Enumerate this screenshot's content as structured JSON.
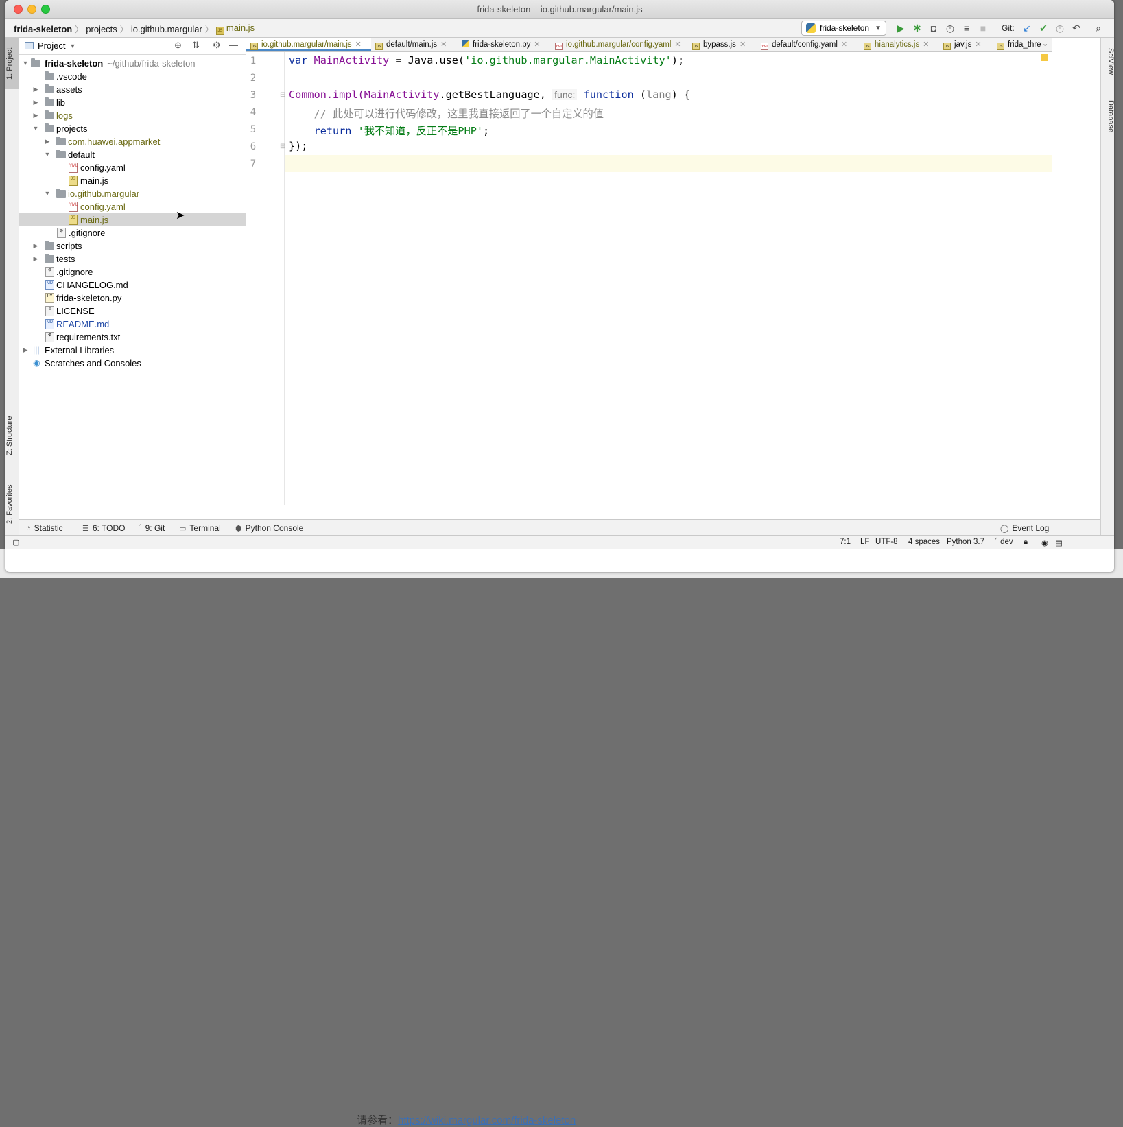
{
  "window": {
    "title": "frida-skeleton – io.github.margular/main.js"
  },
  "breadcrumbs": [
    "frida-skeleton",
    "projects",
    "io.github.margular",
    "main.js"
  ],
  "run_config": {
    "name": "frida-skeleton"
  },
  "git_label": "Git:",
  "left_tool_tabs": [
    "1: Project",
    "Z: Structure",
    "2: Favorites"
  ],
  "right_tool_tabs": [
    "SciView",
    "Database"
  ],
  "project_panel": {
    "title": "Project",
    "tree": [
      {
        "label": "frida-skeleton",
        "extra": "~/github/frida-skeleton"
      },
      {
        "label": ".vscode"
      },
      {
        "label": "assets"
      },
      {
        "label": "lib"
      },
      {
        "label": "logs"
      },
      {
        "label": "projects"
      },
      {
        "label": "com.huawei.appmarket"
      },
      {
        "label": "default"
      },
      {
        "label": "config.yaml"
      },
      {
        "label": "main.js"
      },
      {
        "label": "io.github.margular"
      },
      {
        "label": "config.yaml"
      },
      {
        "label": "main.js"
      },
      {
        "label": ".gitignore"
      },
      {
        "label": "scripts"
      },
      {
        "label": "tests"
      },
      {
        "label": ".gitignore"
      },
      {
        "label": "CHANGELOG.md"
      },
      {
        "label": "frida-skeleton.py"
      },
      {
        "label": "LICENSE"
      },
      {
        "label": "README.md"
      },
      {
        "label": "requirements.txt"
      },
      {
        "label": "External Libraries"
      },
      {
        "label": "Scratches and Consoles"
      }
    ]
  },
  "tabs": [
    {
      "label": "io.github.margular/main.js"
    },
    {
      "label": "default/main.js"
    },
    {
      "label": "frida-skeleton.py"
    },
    {
      "label": "io.github.margular/config.yaml"
    },
    {
      "label": "bypass.js"
    },
    {
      "label": "default/config.yaml"
    },
    {
      "label": "hianalytics.js"
    },
    {
      "label": "jav.js"
    },
    {
      "label": "frida_threa"
    }
  ],
  "editor": {
    "line_numbers": [
      "1",
      "2",
      "3",
      "4",
      "5",
      "6",
      "7"
    ],
    "line1": {
      "kw": "var",
      "name": "MainActivity",
      "eq": " = ",
      "java": "Java.use(",
      "str": "'io.github.margular.MainActivity'",
      "end": ");"
    },
    "line3": {
      "a": "Common.impl(",
      "b": "MainActivity",
      "c": ".getBestLanguage, ",
      "hint": "func:",
      "kw": "function",
      "open": " (",
      "param": "lang",
      "close": ") {"
    },
    "line4": {
      "comment": "    // 此处可以进行代码修改，这里我直接返回了一个自定义的值"
    },
    "line5": {
      "kw": "    return ",
      "str": "'我不知道，反正不是PHP'",
      "end": ";"
    },
    "line6": {
      "text": "});"
    }
  },
  "bottom_tools": [
    {
      "label": "Statistic"
    },
    {
      "label": "6: TODO"
    },
    {
      "label": "9: Git"
    },
    {
      "label": "Terminal"
    },
    {
      "label": "Python Console"
    },
    {
      "label": "Event Log"
    }
  ],
  "status": {
    "position": "7:1",
    "line_sep": "LF",
    "encoding": "UTF-8",
    "indent": "4 spaces",
    "interpreter": "Python 3.7",
    "branch": "dev"
  },
  "background": {
    "prefix": "请参看：",
    "link": "https://wiki.margular.com/frida-skeleton"
  }
}
